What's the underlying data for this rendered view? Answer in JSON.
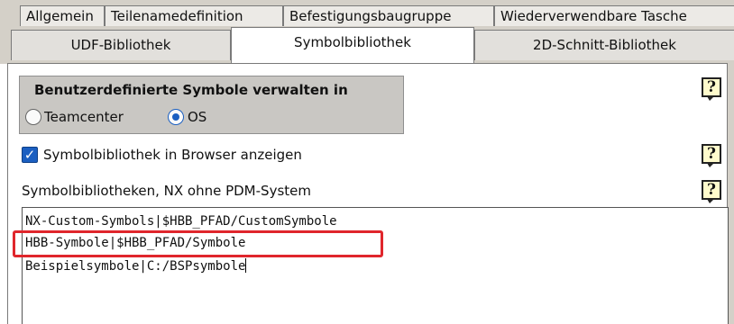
{
  "tabs_row1": [
    {
      "label": "Allgemein"
    },
    {
      "label": "Teilenamedefinition"
    },
    {
      "label": "Befestigungsbaugruppe"
    },
    {
      "label": "Wiederverwendbare Tasche"
    }
  ],
  "tabs_row2": [
    {
      "label": "UDF-Bibliothek",
      "active": false
    },
    {
      "label": "Symbolbibliothek",
      "active": true
    },
    {
      "label": "2D-Schnitt-Bibliothek",
      "active": false
    }
  ],
  "group": {
    "title": "Benutzerdefinierte Symbole verwalten in",
    "options": [
      {
        "label": "Teamcenter",
        "selected": false
      },
      {
        "label": "OS",
        "selected": true
      }
    ]
  },
  "show_in_browser": {
    "label": "Symbolbibliothek in Browser anzeigen",
    "checked": true
  },
  "libraries": {
    "label": "Symbolbibliotheken, NX ohne PDM-System",
    "lines": [
      "NX-Custom-Symbols|$HBB_PFAD/CustomSymbole",
      "HBB-Symbole|$HBB_PFAD/Symbole",
      "Beispielsymbole|C:/BSPsymbole"
    ]
  },
  "help_glyph": "?",
  "check_glyph": "✓",
  "colors": {
    "highlight": "#e0262c",
    "accent": "#1b5fc1"
  }
}
